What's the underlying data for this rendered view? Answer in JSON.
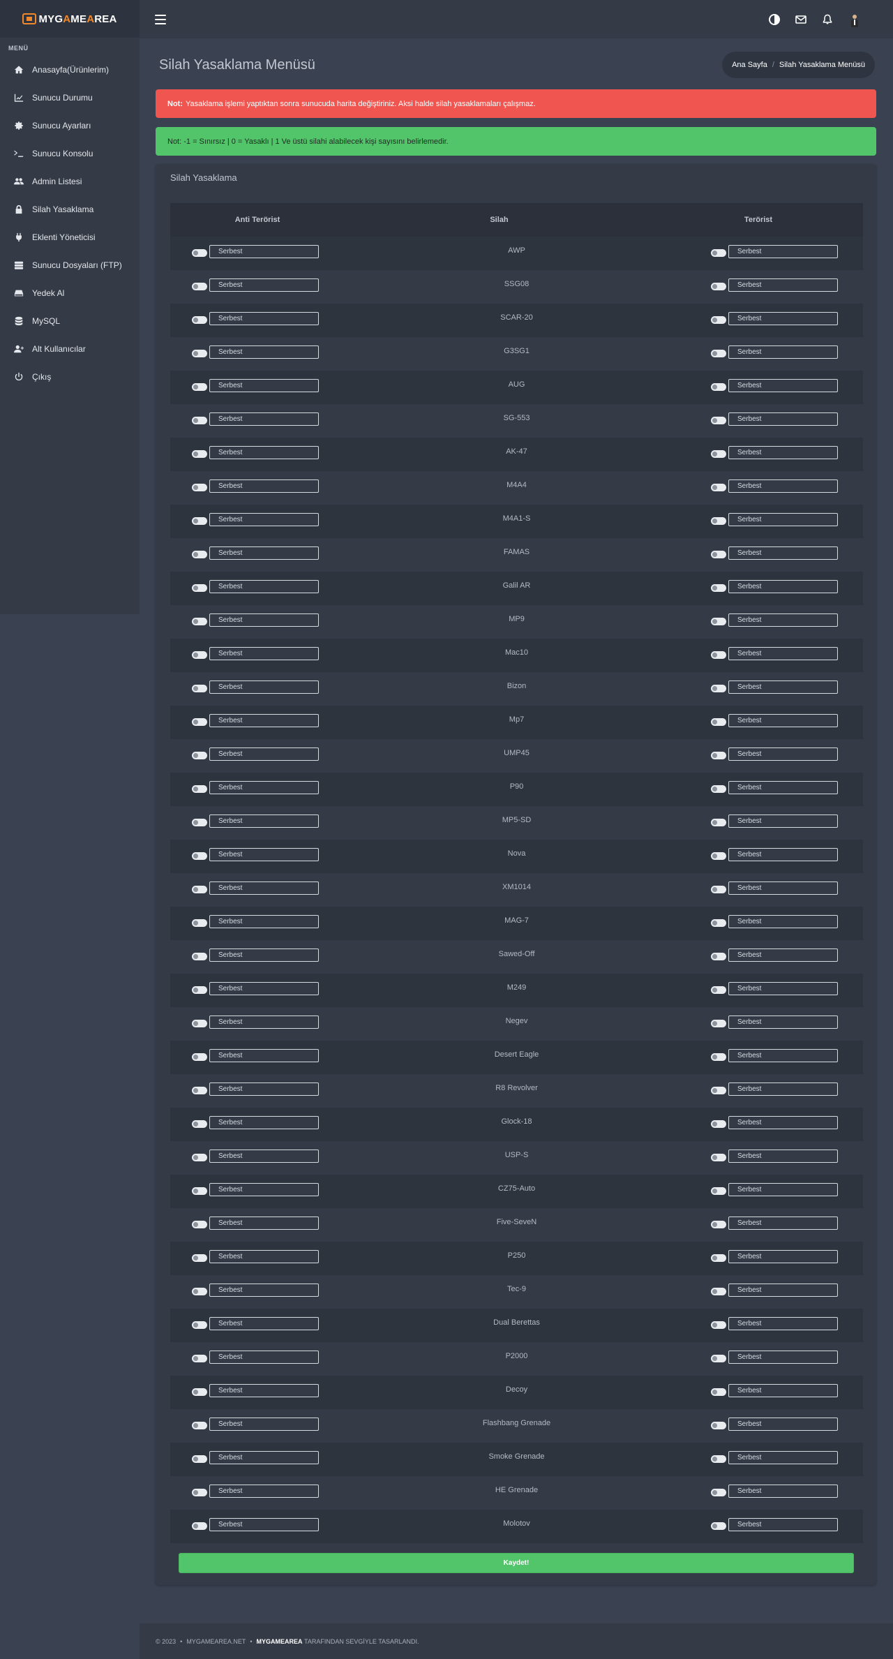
{
  "brand": {
    "prefix": "MYG",
    "accent": "A",
    "mid": "ME",
    "accent2": "A",
    "suffix": "REA"
  },
  "sidebar": {
    "header": "MENÜ",
    "items": [
      {
        "label": "Anasayfa(Ürünlerim)",
        "icon": "home-icon"
      },
      {
        "label": "Sunucu Durumu",
        "icon": "chart-icon"
      },
      {
        "label": "Sunucu Ayarları",
        "icon": "gear-icon"
      },
      {
        "label": "Sunucu Konsolu",
        "icon": "terminal-icon"
      },
      {
        "label": "Admin Listesi",
        "icon": "users-icon"
      },
      {
        "label": "Silah Yasaklama",
        "icon": "lock-icon"
      },
      {
        "label": "Eklenti Yöneticisi",
        "icon": "plug-icon"
      },
      {
        "label": "Sunucu Dosyaları (FTP)",
        "icon": "server-icon"
      },
      {
        "label": "Yedek Al",
        "icon": "hdd-icon"
      },
      {
        "label": "MySQL",
        "icon": "database-icon"
      },
      {
        "label": "Alt Kullanıcılar",
        "icon": "user-plus-icon"
      },
      {
        "label": "Çıkış",
        "icon": "power-icon"
      }
    ]
  },
  "topbar": {
    "icons": [
      "menu-icon",
      "theme-toggle-icon",
      "mail-icon",
      "bell-icon",
      "avatar"
    ]
  },
  "header": {
    "title": "Silah Yasaklama Menüsü",
    "breadcrumb": [
      "Ana Sayfa",
      "Silah Yasaklama Menüsü"
    ]
  },
  "alerts": {
    "danger_strong": "Not:",
    "danger_text": "Yasaklama işlemi yaptıktan sonra sunucuda harita değiştiriniz. Aksi halde silah yasaklamaları çalışmaz.",
    "success_text": "Not: -1 = Sınırsız | 0 = Yasaklı | 1 Ve üstü silahi alabilecek kişi sayısını belirlemedir."
  },
  "card": {
    "title": "Silah Yasaklama",
    "columns": [
      "Anti Terörist",
      "Silah",
      "Terörist"
    ],
    "placeholder": "Serbest",
    "weapons": [
      "AWP",
      "SSG08",
      "SCAR-20",
      "G3SG1",
      "AUG",
      "SG-553",
      "AK-47",
      "M4A4",
      "M4A1-S",
      "FAMAS",
      "Galil AR",
      "MP9",
      "Mac10",
      "Bizon",
      "Mp7",
      "UMP45",
      "P90",
      "MP5-SD",
      "Nova",
      "XM1014",
      "MAG-7",
      "Sawed-Off",
      "M249",
      "Negev",
      "Desert Eagle",
      "R8 Revolver",
      "Glock-18",
      "USP-S",
      "CZ75-Auto",
      "Five-SeveN",
      "P250",
      "Tec-9",
      "Dual Berettas",
      "P2000",
      "Decoy",
      "Flashbang Grenade",
      "Smoke Grenade",
      "HE Grenade",
      "Molotov"
    ],
    "save_label": "Kaydet!"
  },
  "footer": {
    "copyright": "© 2023",
    "site": "MYGAMEAREA.NET",
    "brand": "MYGAMEAREA",
    "tagline": "TARAFINDAN SEVGİYLE TASARLANDI."
  },
  "colors": {
    "accent": "#f0882c",
    "danger": "#f0554f",
    "success": "#52c56a",
    "bg": "#3a4252",
    "panel": "#343a46"
  }
}
